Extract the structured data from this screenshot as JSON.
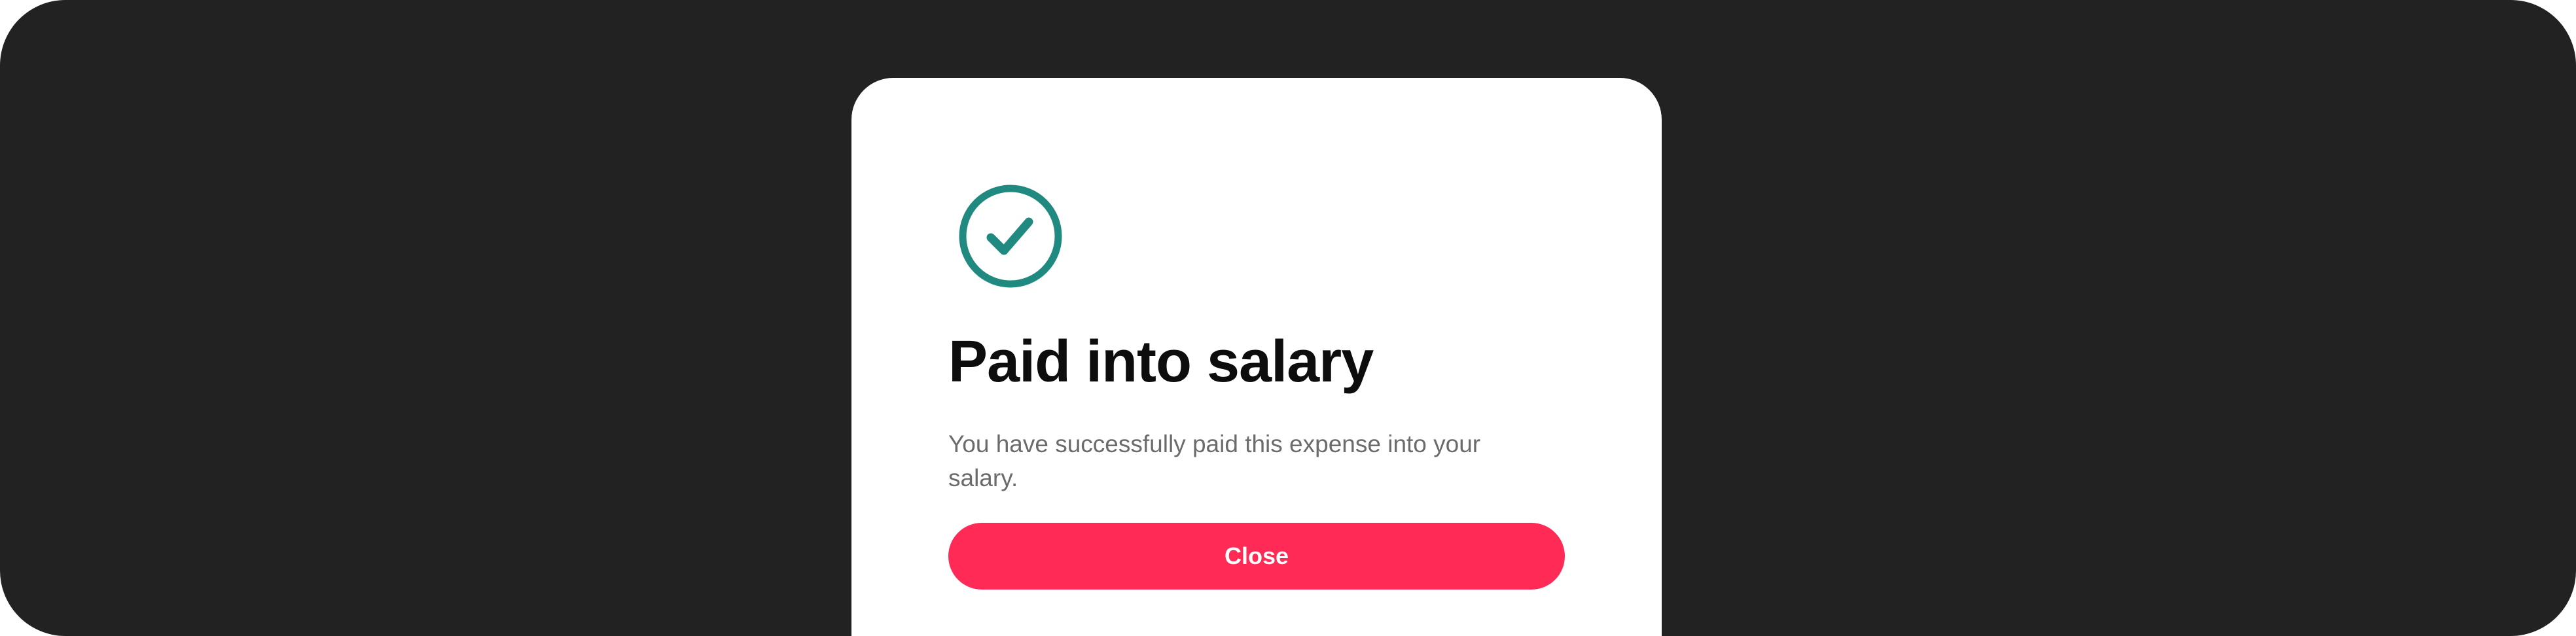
{
  "dialog": {
    "icon": "check-circle-icon",
    "icon_color": "#218A80",
    "title": "Paid into salary",
    "message": "You have successfully paid this expense into your salary.",
    "close_label": "Close",
    "accent_color": "#FF2A55"
  }
}
